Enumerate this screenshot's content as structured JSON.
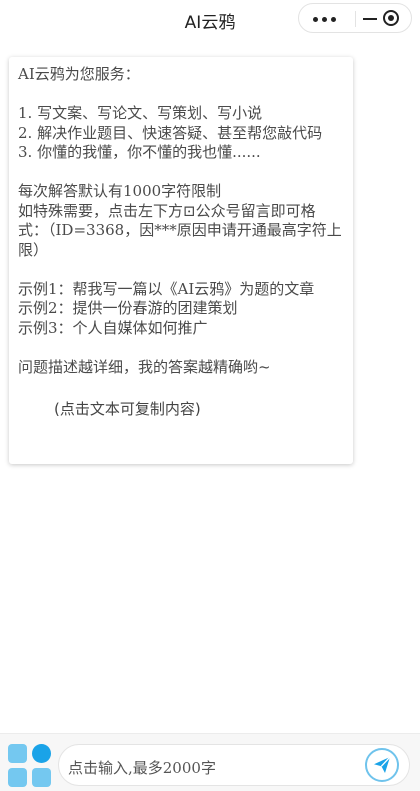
{
  "header": {
    "title": "AI云鸦"
  },
  "capsule": {
    "more_icon": "more-dots-icon",
    "minimize_icon": "minimize-icon",
    "close_icon": "target-circle-icon"
  },
  "message": {
    "lines": [
      "AI云鸦为您服务：",
      "",
      "1. 写文案、写论文、写策划、写小说",
      "2. 解决作业题目、快速答疑、甚至帮您敲代码",
      "3. 你懂的我懂，你不懂的我也懂......",
      "",
      "每次解答默认有1000字符限制",
      "如特殊需要，点击左下方⊡公众号留言即可格式：（ID=3368，因***原因申请开通最高字符上限）",
      "",
      "示例1：帮我写一篇以《AI云鸦》为题的文章",
      "示例2：提供一份春游的团建策划",
      "示例3：个人自媒体如何推广",
      "",
      "问题描述越详细，我的答案越精确哟~"
    ],
    "copy_hint": "(点击文本可复制内容)"
  },
  "input_bar": {
    "placeholder": "点击输入,最多2000字",
    "menu_icon": "grid-menu-icon",
    "send_icon": "send-paper-plane-icon"
  },
  "colors": {
    "accent_light": "#74c8f0",
    "accent_dark": "#1aa3e8"
  }
}
